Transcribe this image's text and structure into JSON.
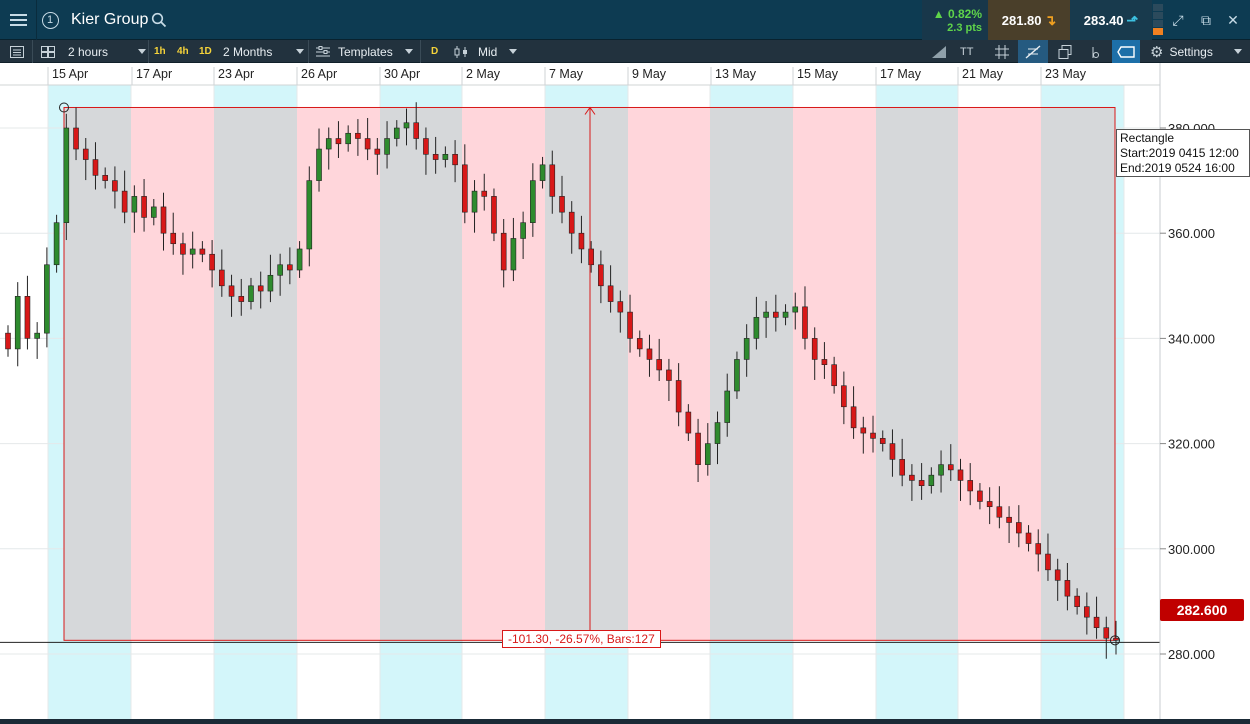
{
  "header": {
    "title": "Kier Group",
    "change_pct": "▲ 0.82%",
    "change_pts": "2.3 pts",
    "sell_price": "281.80",
    "buy_price": "283.40",
    "workspace_number": "1"
  },
  "toolbar": {
    "interval": "2 hours",
    "quick_intervals": [
      "1h",
      "4h",
      "1D"
    ],
    "range": "2 Months",
    "templates": "Templates",
    "d_badge": "D",
    "price_type": "Mid",
    "text_tool": "TT",
    "settings": "Settings"
  },
  "chart": {
    "x_ticks": [
      "15 Apr",
      "17 Apr",
      "23 Apr",
      "26 Apr",
      "30 Apr",
      "2 May",
      "7 May",
      "9 May",
      "13 May",
      "15 May",
      "17 May",
      "21 May",
      "23 May"
    ],
    "y_ticks": [
      "380.000",
      "360.000",
      "340.000",
      "320.000",
      "300.000",
      "280.000"
    ],
    "current_price": "282.600",
    "rectangle_info": {
      "title": "Rectangle",
      "start": "Start:2019 0415 12:00",
      "end": "End:2019 0524 16:00"
    },
    "measure": "-101.30, -26.57%, Bars:127"
  },
  "colors": {
    "up": "#2e8b2e",
    "down": "#d81818",
    "rect_fill": "#ffd6db",
    "band_cyan": "#d3f6fa",
    "band_grey": "#d6d8da"
  },
  "chart_data": {
    "type": "candlestick",
    "x": [
      "15 Apr",
      "17 Apr",
      "23 Apr",
      "26 Apr",
      "30 Apr",
      "2 May",
      "7 May",
      "9 May",
      "13 May",
      "15 May",
      "17 May",
      "21 May",
      "23 May"
    ],
    "ylim": [
      270,
      389
    ],
    "current_price": 282.6,
    "rectangle": {
      "y_top": 383.9,
      "y_bottom": 282.6,
      "change": -101.3,
      "change_pct": -26.57,
      "bars": 127
    },
    "closes": [
      338,
      348,
      340,
      341,
      354,
      362,
      380,
      376,
      374,
      371,
      370,
      368,
      364,
      367,
      363,
      365,
      360,
      358,
      356,
      357,
      356,
      353,
      350,
      348,
      347,
      350,
      349,
      352,
      354,
      353,
      357,
      370,
      376,
      378,
      377,
      379,
      378,
      376,
      375,
      378,
      380,
      381,
      378,
      375,
      374,
      375,
      373,
      364,
      368,
      367,
      360,
      353,
      359,
      362,
      370,
      373,
      367,
      364,
      360,
      357,
      354,
      350,
      347,
      345,
      340,
      338,
      336,
      334,
      332,
      326,
      322,
      316,
      320,
      324,
      330,
      336,
      340,
      344,
      345,
      344,
      345,
      346,
      340,
      336,
      335,
      331,
      327,
      323,
      322,
      321,
      320,
      317,
      314,
      313,
      312,
      314,
      316,
      315,
      313,
      311,
      309,
      308,
      306,
      305,
      303,
      301,
      299,
      296,
      294,
      291,
      289,
      287,
      285,
      283,
      282.6
    ]
  }
}
